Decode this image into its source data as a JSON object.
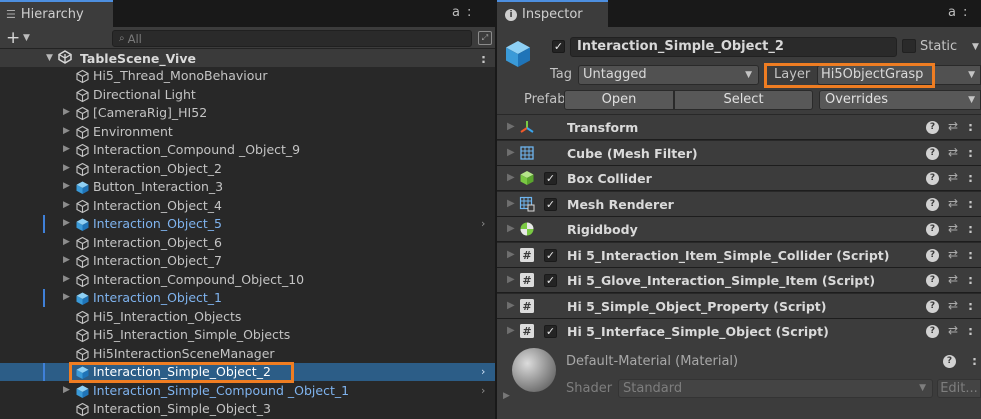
{
  "hierarchy": {
    "tab_label": "Hierarchy",
    "tab_lock_glyph": "a",
    "tab_menu_glyph": ":",
    "add_glyph": "+",
    "search_placeholder": "All",
    "scene": {
      "name": "TableScene_Vive",
      "more_glyph": ":"
    },
    "items": [
      {
        "name": "Hi5_Thread_MonoBehaviour",
        "icon": "gameobject-icon",
        "foldout": false,
        "prefab": false,
        "selected": false,
        "arrow": false,
        "bar": false
      },
      {
        "name": "Directional Light",
        "icon": "gameobject-icon",
        "foldout": false,
        "prefab": false,
        "selected": false,
        "arrow": false,
        "bar": false
      },
      {
        "name": "[CameraRig]_HI52",
        "icon": "gameobject-icon",
        "foldout": true,
        "prefab": false,
        "selected": false,
        "arrow": false,
        "bar": false
      },
      {
        "name": "Environment",
        "icon": "gameobject-icon",
        "foldout": true,
        "prefab": false,
        "selected": false,
        "arrow": false,
        "bar": false
      },
      {
        "name": "Interaction_Compound _Object_9",
        "icon": "gameobject-icon",
        "foldout": true,
        "prefab": false,
        "selected": false,
        "arrow": false,
        "bar": false
      },
      {
        "name": "Interaction_Object_2",
        "icon": "gameobject-icon",
        "foldout": true,
        "prefab": false,
        "selected": false,
        "arrow": false,
        "bar": false
      },
      {
        "name": "Button_Interaction_3",
        "icon": "prefab-cube-icon",
        "foldout": true,
        "prefab": false,
        "selected": false,
        "arrow": false,
        "bar": false
      },
      {
        "name": "Interaction_Object_4",
        "icon": "gameobject-icon",
        "foldout": true,
        "prefab": false,
        "selected": false,
        "arrow": false,
        "bar": false
      },
      {
        "name": "Interaction_Object_5",
        "icon": "prefab-cube-icon",
        "foldout": true,
        "prefab": true,
        "selected": false,
        "arrow": true,
        "bar": true
      },
      {
        "name": "Interaction_Object_6",
        "icon": "gameobject-icon",
        "foldout": true,
        "prefab": false,
        "selected": false,
        "arrow": false,
        "bar": false
      },
      {
        "name": "Interaction_Object_7",
        "icon": "gameobject-icon",
        "foldout": true,
        "prefab": false,
        "selected": false,
        "arrow": false,
        "bar": false
      },
      {
        "name": "Interaction_Compound_Object_10",
        "icon": "gameobject-icon",
        "foldout": true,
        "prefab": false,
        "selected": false,
        "arrow": false,
        "bar": false
      },
      {
        "name": "Interaction_Object_1",
        "icon": "prefab-cube-icon",
        "foldout": true,
        "prefab": true,
        "selected": false,
        "arrow": false,
        "bar": true
      },
      {
        "name": "Hi5_Interaction_Objects",
        "icon": "gameobject-icon",
        "foldout": false,
        "prefab": false,
        "selected": false,
        "arrow": false,
        "bar": false
      },
      {
        "name": "Hi5_Interaction_Simple_Objects",
        "icon": "gameobject-icon",
        "foldout": false,
        "prefab": false,
        "selected": false,
        "arrow": false,
        "bar": false
      },
      {
        "name": "Hi5InteractionSceneManager",
        "icon": "gameobject-icon",
        "foldout": false,
        "prefab": false,
        "selected": false,
        "arrow": false,
        "bar": false
      },
      {
        "name": "Interaction_Simple_Object_2",
        "icon": "prefab-cube-icon",
        "foldout": false,
        "prefab": true,
        "selected": true,
        "arrow": true,
        "bar": true
      },
      {
        "name": "Interaction_Simple_Compound _Object_1",
        "icon": "prefab-cube-icon",
        "foldout": true,
        "prefab": true,
        "selected": false,
        "arrow": true,
        "bar": false
      },
      {
        "name": "Interaction_Simple_Object_3",
        "icon": "gameobject-icon",
        "foldout": false,
        "prefab": false,
        "selected": false,
        "arrow": false,
        "bar": false
      }
    ]
  },
  "inspector": {
    "tab_label": "Inspector",
    "tab_icon_glyph": "i",
    "tab_lock_glyph": "a",
    "tab_menu_glyph": ":",
    "object_active_glyph": "✓",
    "object_name": "Interaction_Simple_Object_2",
    "static_label": "Static",
    "tag_label": "Tag",
    "tag_value": "Untagged",
    "layer_label": "Layer",
    "layer_value": "Hi5ObjectGrasp",
    "prefab_label": "Prefab",
    "open_label": "Open",
    "select_label": "Select",
    "overrides_label": "Overrides",
    "components": [
      {
        "name": "Transform",
        "icon": "transform-icon",
        "checkbox": false
      },
      {
        "name": "Cube (Mesh Filter)",
        "icon": "mesh-filter-icon",
        "checkbox": false
      },
      {
        "name": "Box Collider",
        "icon": "box-collider-icon",
        "checkbox": true
      },
      {
        "name": "Mesh Renderer",
        "icon": "mesh-renderer-icon",
        "checkbox": true
      },
      {
        "name": "Rigidbody",
        "icon": "rigidbody-icon",
        "checkbox": false
      },
      {
        "name": "Hi 5_Interaction_Item_Simple_Collider (Script)",
        "icon": "script-icon",
        "checkbox": true
      },
      {
        "name": "Hi 5_Glove_Interaction_Simple_Item (Script)",
        "icon": "script-icon",
        "checkbox": true
      },
      {
        "name": "Hi 5_Simple_Object_Property (Script)",
        "icon": "script-icon",
        "checkbox": false
      },
      {
        "name": "Hi 5_Interface_Simple_Object (Script)",
        "icon": "script-icon",
        "checkbox": true
      }
    ],
    "component_help_glyph": "?",
    "component_preset_glyph": "⇄",
    "component_more_glyph": ":",
    "material": {
      "name": "Default-Material (Material)",
      "shader_label": "Shader",
      "shader_value": "Standard",
      "edit_label": "Edit...",
      "help_glyph": "?",
      "more_glyph": ":"
    }
  },
  "colors": {
    "panel_bg": "#282828",
    "header_bg": "#3c3c3c",
    "selection": "#2c5d87",
    "prefab_text": "#7fb3ee",
    "highlight": "#ef7d22",
    "accent": "#4d8fe0"
  }
}
